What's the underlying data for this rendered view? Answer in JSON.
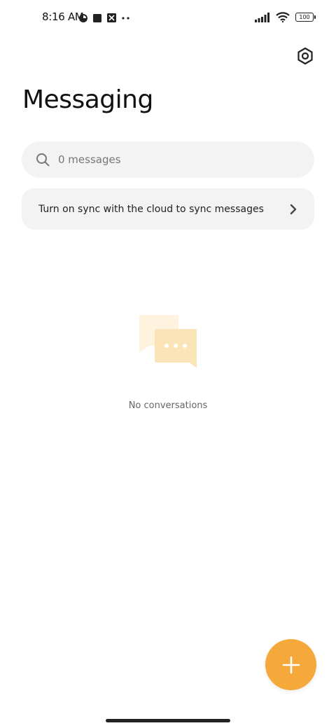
{
  "status_bar": {
    "time": "8:16 AM",
    "battery_level": "100",
    "left_icons": [
      "data-saver-icon",
      "square-app-icon",
      "app-notification-icon",
      "more-dots-icon"
    ],
    "right_icons": [
      "signal-icon",
      "wifi-icon",
      "battery-icon"
    ]
  },
  "header": {
    "title": "Messaging",
    "settings_icon": "settings-icon"
  },
  "search": {
    "placeholder": "0 messages"
  },
  "sync_banner": {
    "text": "Turn on sync with the cloud to sync messages"
  },
  "empty_state": {
    "text": "No conversations",
    "icon": "chat-bubbles-icon"
  },
  "fab": {
    "icon": "plus-icon",
    "color": "#f5a93b"
  },
  "colors": {
    "accent": "#f5a93b",
    "surface": "#f3f3f3",
    "text": "#222222"
  }
}
